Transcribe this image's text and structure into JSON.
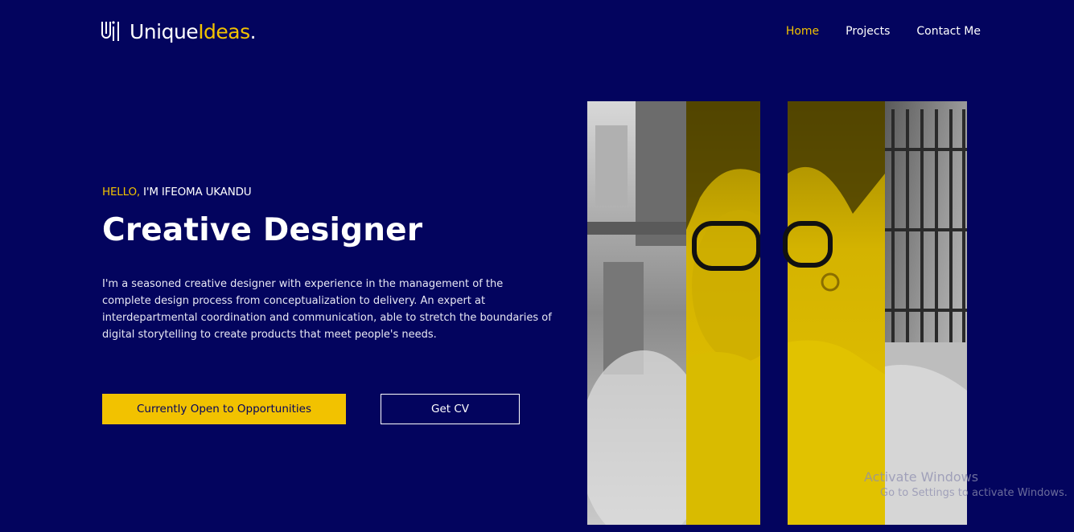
{
  "header": {
    "logo": {
      "name_part": "Unique",
      "accent_part": "Ideas",
      "dot": "."
    },
    "nav": [
      {
        "label": "Home",
        "active": true
      },
      {
        "label": "Projects",
        "active": false
      },
      {
        "label": "Contact Me",
        "active": false
      }
    ]
  },
  "hero": {
    "greeting_highlight": "HELLO,",
    "greeting_rest": " I'M IFEOMA UKANDU",
    "title": "Creative Designer",
    "description": "I'm a seasoned creative designer with experience in the management of the complete design process from conceptualization to delivery. An expert at interdepartmental coordination and communication, able to stretch the boundaries of digital storytelling to create products that meet people's needs.",
    "primary_button": "Currently Open to Opportunities",
    "secondary_button": "Get CV"
  },
  "watermark": {
    "title": "Activate Windows",
    "subtitle": "Go to Settings to activate Windows."
  },
  "colors": {
    "background": "#03045e",
    "accent": "#f2c200",
    "text": "#ffffff"
  }
}
